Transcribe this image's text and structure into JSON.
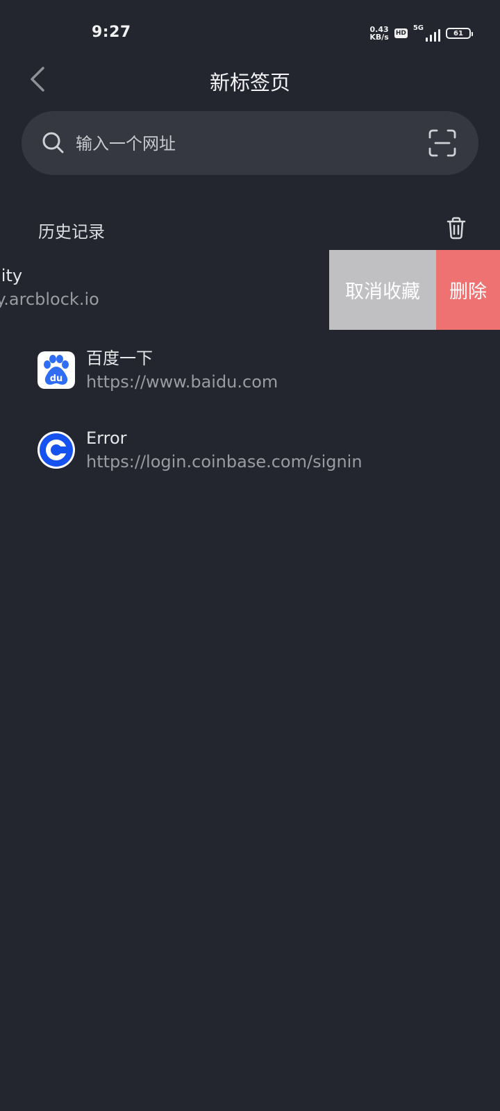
{
  "status_bar": {
    "time": "9:27",
    "net_speed_value": "0.43",
    "net_speed_unit": "KB/s",
    "hd": "HD",
    "network": "5G",
    "battery": "61"
  },
  "header": {
    "title": "新标签页"
  },
  "search": {
    "placeholder": "输入一个网址"
  },
  "history": {
    "title": "历史记录",
    "items": [
      {
        "title": "munity",
        "url": "unity.arcblock.io",
        "actions": {
          "unfavorite": "取消收藏",
          "delete": "删除"
        }
      },
      {
        "title": "百度一下",
        "url": "https://www.baidu.com",
        "icon": "baidu-icon",
        "icon_color": "#2f6df5"
      },
      {
        "title": "Error",
        "url": "https://login.coinbase.com/signin",
        "icon": "coinbase-icon",
        "icon_color": "#1652f0"
      }
    ]
  },
  "colors": {
    "background": "#23262e",
    "search_bg": "#353840",
    "unfavorite_bg": "#c0c0c2",
    "delete_bg": "#ee7272"
  }
}
